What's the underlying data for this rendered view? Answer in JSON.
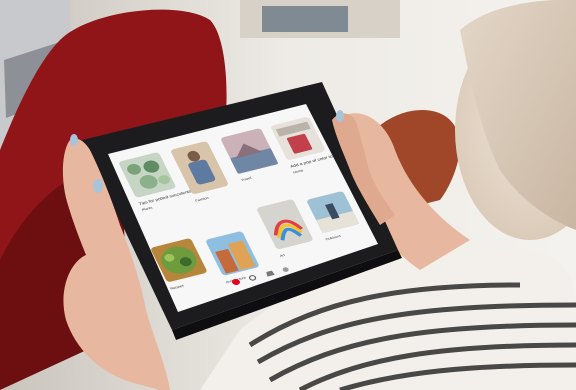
{
  "scene": {
    "subject": "person using a tablet showing a Pinterest home feed",
    "palette": {
      "background": "#e9e5df",
      "wall": "#f2efe9",
      "chair_red": "#8f1518",
      "tablet_frame": "#1c1c1e",
      "screen": "#f7f7f7",
      "skin": "#e7b79f",
      "nail": "#a9c4d9",
      "shirt_stripe": "#2b2b2b",
      "pinterest_red": "#e60023"
    }
  },
  "feed": {
    "pins": [
      {
        "caption": "Tips for potted succulents",
        "board": "Plants"
      },
      {
        "caption": "",
        "board": "Fashion"
      },
      {
        "caption": "",
        "board": "Travel"
      },
      {
        "caption": "Add a pop of color to your deck",
        "board": "Home"
      },
      {
        "caption": "",
        "board": "Recipes"
      },
      {
        "caption": "",
        "board": "Architecture"
      },
      {
        "caption": "",
        "board": "Art"
      },
      {
        "caption": "",
        "board": "Outdoors"
      }
    ],
    "nav_icons": [
      "home-icon",
      "search-icon",
      "notifications-icon",
      "profile-icon"
    ]
  }
}
